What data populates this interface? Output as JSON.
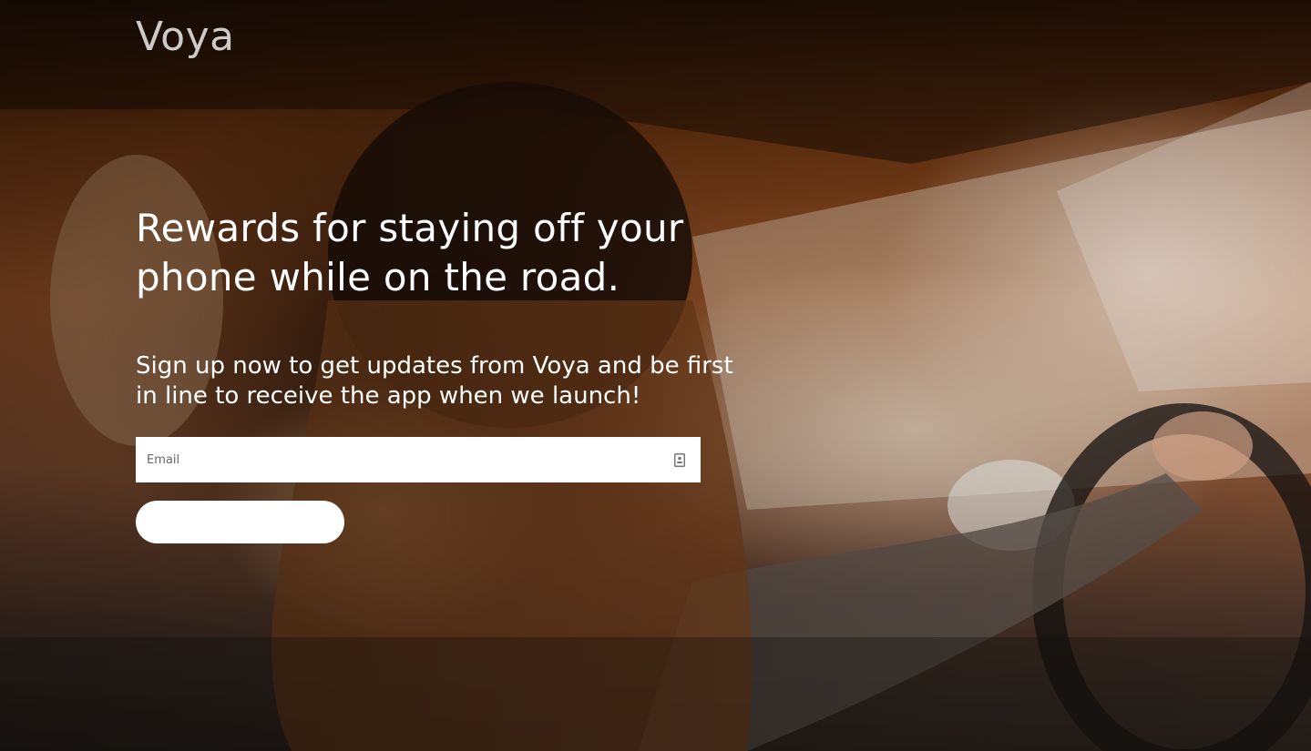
{
  "brand": {
    "logo_text": "Voya"
  },
  "hero": {
    "headline": "Rewards for staying off your phone while on the road.",
    "subhead": "Sign up now to get updates from Voya and be first in line to receive the app when we launch!",
    "background_image": "woman-driving-car-sunlight"
  },
  "signup": {
    "email_placeholder": "Email",
    "email_value": "",
    "contact_icon": "contact-card-icon",
    "submit_label": ""
  },
  "colors": {
    "text": "#ffffff",
    "field_background": "#ffffff",
    "button_background": "#ffffff"
  }
}
